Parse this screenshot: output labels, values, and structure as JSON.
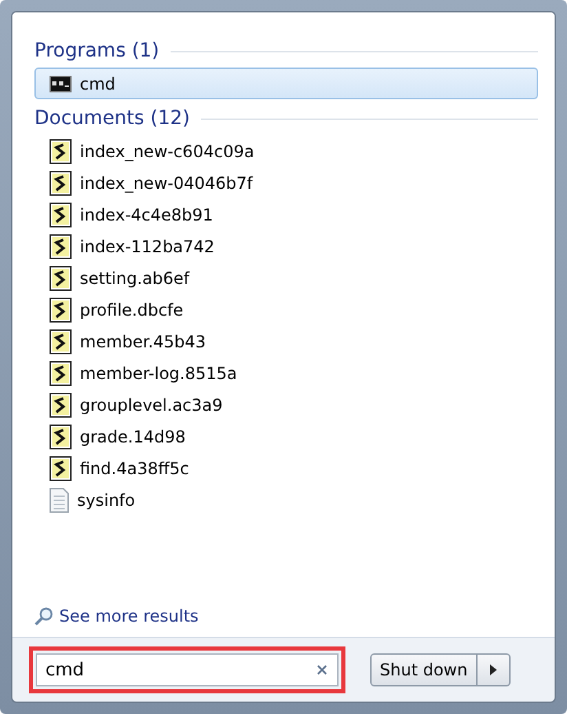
{
  "groups": [
    {
      "heading": "Programs (1)",
      "items": [
        {
          "label": "cmd",
          "kind": "console",
          "selected": true
        }
      ]
    },
    {
      "heading": "Documents (12)",
      "items": [
        {
          "label": "index_new-c604c09a",
          "kind": "script",
          "selected": false
        },
        {
          "label": "index_new-04046b7f",
          "kind": "script",
          "selected": false
        },
        {
          "label": "index-4c4e8b91",
          "kind": "script",
          "selected": false
        },
        {
          "label": "index-112ba742",
          "kind": "script",
          "selected": false
        },
        {
          "label": "setting.ab6ef",
          "kind": "script",
          "selected": false
        },
        {
          "label": "profile.dbcfe",
          "kind": "script",
          "selected": false
        },
        {
          "label": "member.45b43",
          "kind": "script",
          "selected": false
        },
        {
          "label": "member-log.8515a",
          "kind": "script",
          "selected": false
        },
        {
          "label": "grouplevel.ac3a9",
          "kind": "script",
          "selected": false
        },
        {
          "label": "grade.14d98",
          "kind": "script",
          "selected": false
        },
        {
          "label": "find.4a38ff5c",
          "kind": "script",
          "selected": false
        },
        {
          "label": "sysinfo",
          "kind": "text",
          "selected": false
        }
      ]
    }
  ],
  "see_more": "See more results",
  "search": {
    "value": "cmd",
    "highlighted": true
  },
  "shutdown": {
    "label": "Shut down"
  }
}
